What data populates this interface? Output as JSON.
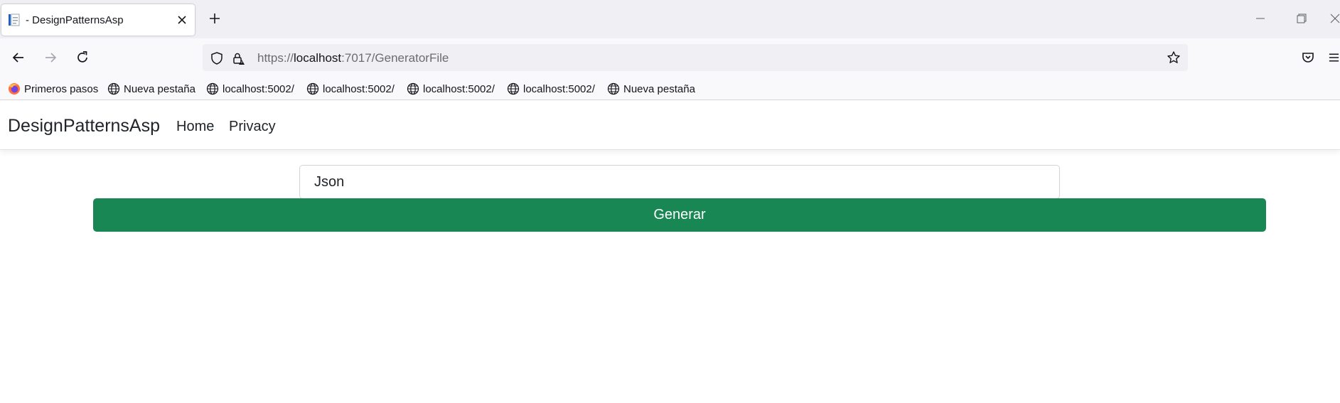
{
  "browser": {
    "tab": {
      "title": "- DesignPatternsAsp"
    },
    "url": {
      "scheme": "https://",
      "host": "localhost",
      "rest": ":7017/GeneratorFile"
    },
    "bookmarks": [
      {
        "label": "Primeros pasos",
        "icon": "firefox-icon"
      },
      {
        "label": "Nueva pestaña",
        "icon": "globe-icon"
      },
      {
        "label": "localhost:5002/",
        "icon": "globe-icon"
      },
      {
        "label": "localhost:5002/",
        "icon": "globe-icon"
      },
      {
        "label": "localhost:5002/",
        "icon": "globe-icon"
      },
      {
        "label": "localhost:5002/",
        "icon": "globe-icon"
      },
      {
        "label": "Nueva pestaña",
        "icon": "globe-icon"
      }
    ]
  },
  "site": {
    "brand": "DesignPatternsAsp",
    "nav": [
      {
        "label": "Home"
      },
      {
        "label": "Privacy"
      }
    ],
    "form": {
      "input_value": "Json",
      "button_label": "Generar"
    }
  },
  "colors": {
    "accent_green": "#198754",
    "chrome_bg": "#f0f0f4",
    "toolbar_bg": "#f9f9fb"
  }
}
